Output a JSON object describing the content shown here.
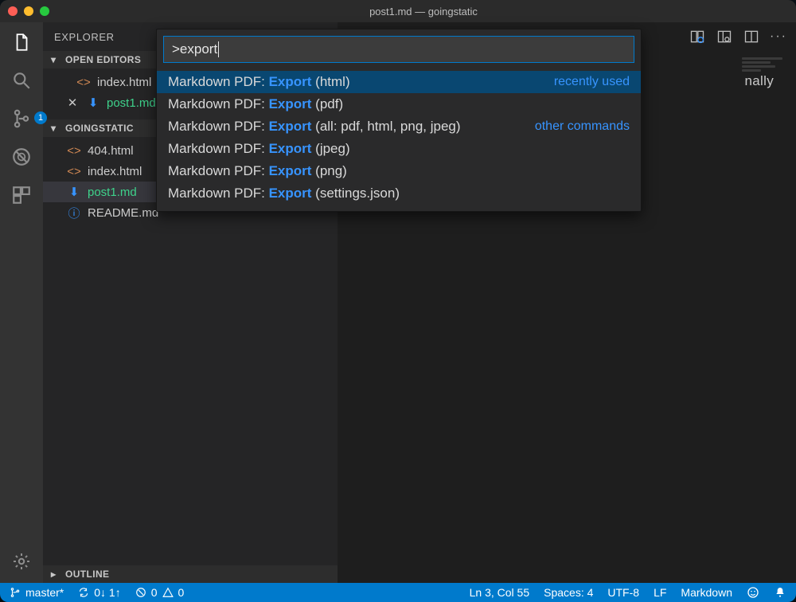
{
  "titlebar": {
    "title": "post1.md — goingstatic"
  },
  "activity": {
    "scm_badge": "1"
  },
  "explorer": {
    "title": "EXPLORER",
    "open_editors_label": "OPEN EDITORS",
    "open_editors": [
      {
        "name": "index.html"
      },
      {
        "name": "post1.md",
        "modified": true,
        "active": true
      }
    ],
    "workspace_label": "GOINGSTATIC",
    "files": [
      {
        "name": "404.html",
        "icon": "code"
      },
      {
        "name": "index.html",
        "icon": "code"
      },
      {
        "name": "post1.md",
        "icon": "md",
        "status": "M",
        "selected": true,
        "active": true
      },
      {
        "name": "README.md",
        "icon": "info"
      }
    ],
    "outline_label": "OUTLINE"
  },
  "editor": {
    "actions": [
      "open-changes",
      "preview",
      "split",
      "more"
    ],
    "text_fragment": "nally"
  },
  "palette": {
    "input": ">export",
    "items": [
      {
        "prefix": "Markdown PDF: ",
        "match": "Export",
        "suffix": " (html)",
        "note": "recently used",
        "selected": true
      },
      {
        "prefix": "Markdown PDF: ",
        "match": "Export",
        "suffix": " (pdf)"
      },
      {
        "prefix": "Markdown PDF: ",
        "match": "Export",
        "suffix": " (all: pdf, html, png, jpeg)",
        "note": "other commands"
      },
      {
        "prefix": "Markdown PDF: ",
        "match": "Export",
        "suffix": " (jpeg)"
      },
      {
        "prefix": "Markdown PDF: ",
        "match": "Export",
        "suffix": " (png)"
      },
      {
        "prefix": "Markdown PDF: ",
        "match": "Export",
        "suffix": " (settings.json)"
      }
    ]
  },
  "status": {
    "branch": "master*",
    "sync": "0↓ 1↑",
    "errors": "0",
    "warnings": "0",
    "cursor": "Ln 3, Col 55",
    "spaces": "Spaces: 4",
    "encoding": "UTF-8",
    "eol": "LF",
    "language": "Markdown"
  }
}
